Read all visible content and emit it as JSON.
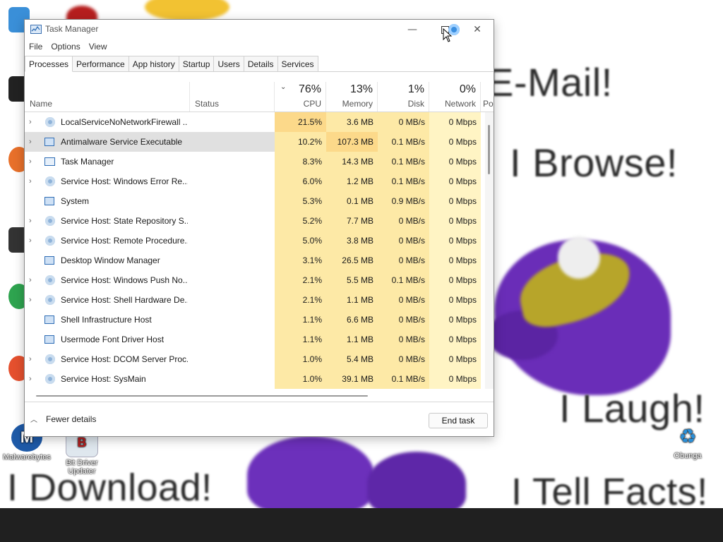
{
  "desktop": {
    "wallpaper_text": [
      "E-Mail!",
      "I Browse!",
      "I Laugh!",
      "I Download!",
      "I Tell Facts!"
    ],
    "icons": [
      {
        "label": "Malwarebytes",
        "icon": "malwarebytes-icon"
      },
      {
        "label": "Bit Driver Updater",
        "icon": "bit-driver-updater-icon"
      },
      {
        "label": "Obunga",
        "icon": "recycle-bin-icon"
      }
    ]
  },
  "window": {
    "title": "Task Manager",
    "controls": {
      "minimize": "—",
      "close": "✕"
    },
    "menu": [
      "File",
      "Options",
      "View"
    ],
    "tabs": [
      "Processes",
      "Performance",
      "App history",
      "Startup",
      "Users",
      "Details",
      "Services"
    ],
    "active_tab": "Processes"
  },
  "columns": {
    "name": "Name",
    "status": "Status",
    "cpu": {
      "label": "CPU",
      "percent": "76%"
    },
    "memory": {
      "label": "Memory",
      "percent": "13%"
    },
    "disk": {
      "label": "Disk",
      "percent": "1%"
    },
    "network": {
      "label": "Network",
      "percent": "0%"
    },
    "power": "Po"
  },
  "processes": [
    {
      "name": "LocalServiceNoNetworkFirewall ...",
      "expandable": true,
      "icon": "gear",
      "cpu": "21.5%",
      "memory": "3.6 MB",
      "disk": "0 MB/s",
      "network": "0 Mbps"
    },
    {
      "name": "Antimalware Service Executable",
      "expandable": true,
      "icon": "window",
      "cpu": "10.2%",
      "memory": "107.3 MB",
      "disk": "0.1 MB/s",
      "network": "0 Mbps",
      "selected": true
    },
    {
      "name": "Task Manager",
      "expandable": true,
      "icon": "taskmgr",
      "cpu": "8.3%",
      "memory": "14.3 MB",
      "disk": "0.1 MB/s",
      "network": "0 Mbps"
    },
    {
      "name": "Service Host: Windows Error Re...",
      "expandable": true,
      "icon": "gear",
      "cpu": "6.0%",
      "memory": "1.2 MB",
      "disk": "0.1 MB/s",
      "network": "0 Mbps"
    },
    {
      "name": "System",
      "expandable": false,
      "icon": "window",
      "cpu": "5.3%",
      "memory": "0.1 MB",
      "disk": "0.9 MB/s",
      "network": "0 Mbps"
    },
    {
      "name": "Service Host: State Repository S...",
      "expandable": true,
      "icon": "gear",
      "cpu": "5.2%",
      "memory": "7.7 MB",
      "disk": "0 MB/s",
      "network": "0 Mbps"
    },
    {
      "name": "Service Host: Remote Procedure...",
      "expandable": true,
      "icon": "gear",
      "cpu": "5.0%",
      "memory": "3.8 MB",
      "disk": "0 MB/s",
      "network": "0 Mbps"
    },
    {
      "name": "Desktop Window Manager",
      "expandable": false,
      "icon": "window",
      "cpu": "3.1%",
      "memory": "26.5 MB",
      "disk": "0 MB/s",
      "network": "0 Mbps"
    },
    {
      "name": "Service Host: Windows Push No...",
      "expandable": true,
      "icon": "gear",
      "cpu": "2.1%",
      "memory": "5.5 MB",
      "disk": "0.1 MB/s",
      "network": "0 Mbps"
    },
    {
      "name": "Service Host: Shell Hardware De...",
      "expandable": true,
      "icon": "gear",
      "cpu": "2.1%",
      "memory": "1.1 MB",
      "disk": "0 MB/s",
      "network": "0 Mbps"
    },
    {
      "name": "Shell Infrastructure Host",
      "expandable": false,
      "icon": "window",
      "cpu": "1.1%",
      "memory": "6.6 MB",
      "disk": "0 MB/s",
      "network": "0 Mbps"
    },
    {
      "name": "Usermode Font Driver Host",
      "expandable": false,
      "icon": "window",
      "cpu": "1.1%",
      "memory": "1.1 MB",
      "disk": "0 MB/s",
      "network": "0 Mbps"
    },
    {
      "name": "Service Host: DCOM Server Proc...",
      "expandable": true,
      "icon": "gear",
      "cpu": "1.0%",
      "memory": "5.4 MB",
      "disk": "0 MB/s",
      "network": "0 Mbps"
    },
    {
      "name": "Service Host: SysMain",
      "expandable": true,
      "icon": "gear",
      "cpu": "1.0%",
      "memory": "39.1 MB",
      "disk": "0.1 MB/s",
      "network": "0 Mbps"
    }
  ],
  "footer": {
    "fewer_details": "Fewer details",
    "end_task": "End task"
  },
  "colors": {
    "heat_high": "#fcd98a",
    "heat_mid": "#fde9a6",
    "heat_low": "#fff4c4",
    "selected_row": "#e0e0e0"
  }
}
